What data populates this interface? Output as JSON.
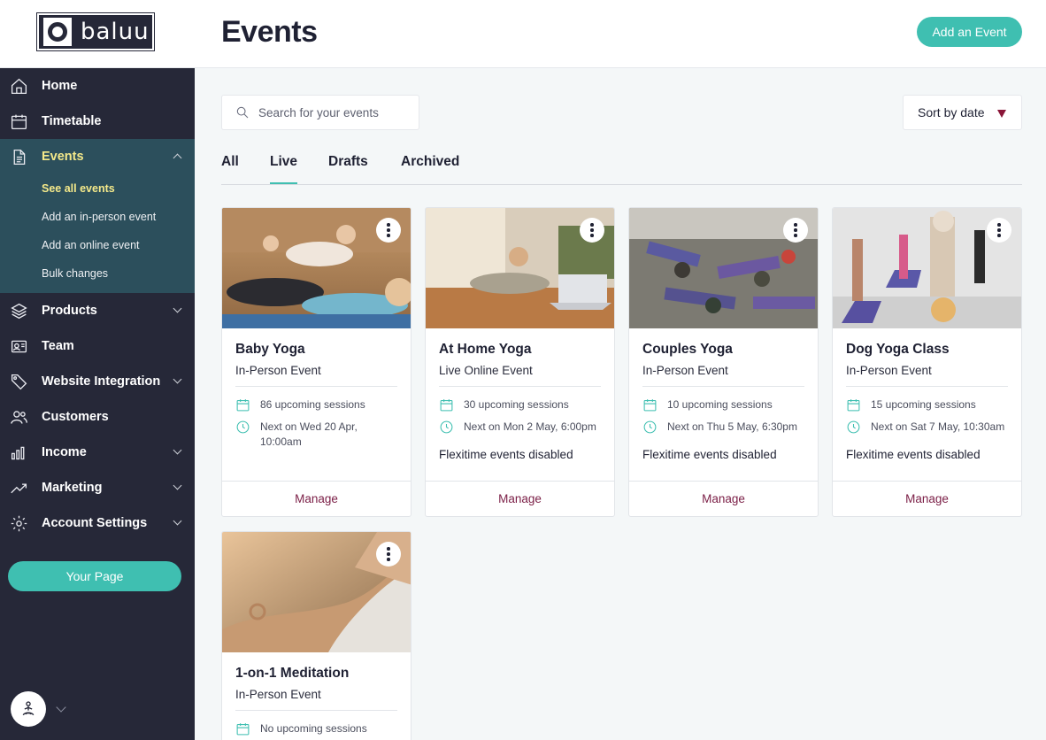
{
  "brand": {
    "name": "baluu",
    "accent": "#3fbfb1",
    "sidebar_bg": "#262838",
    "active_group_bg": "#2c4f5c",
    "highlight": "#f4e98a",
    "manage_color": "#7a1d45"
  },
  "header": {
    "title": "Events",
    "add_button": "Add an Event"
  },
  "sidebar": {
    "items": [
      {
        "label": "Home",
        "icon": "home-icon"
      },
      {
        "label": "Timetable",
        "icon": "calendar-icon"
      },
      {
        "label": "Events",
        "icon": "document-icon",
        "expanded": true,
        "subitems": [
          "See all events",
          "Add an in-person event",
          "Add an online event",
          "Bulk changes"
        ]
      },
      {
        "label": "Products",
        "icon": "layers-icon"
      },
      {
        "label": "Team",
        "icon": "id-card-icon"
      },
      {
        "label": "Website Integration",
        "icon": "tag-icon"
      },
      {
        "label": "Customers",
        "icon": "users-icon"
      },
      {
        "label": "Income",
        "icon": "bar-chart-icon"
      },
      {
        "label": "Marketing",
        "icon": "trend-icon"
      },
      {
        "label": "Account Settings",
        "icon": "gear-icon"
      }
    ],
    "your_page": "Your Page"
  },
  "toolbar": {
    "search_placeholder": "Search for your events",
    "sort_label": "Sort by date"
  },
  "tabs": [
    "All",
    "Live",
    "Drafts",
    "Archived"
  ],
  "active_tab": "Live",
  "events": [
    {
      "title": "Baby Yoga",
      "type": "In-Person Event",
      "sessions": "86 upcoming sessions",
      "next": "Next on Wed 20 Apr, 10:00am",
      "flexi": "",
      "manage": "Manage"
    },
    {
      "title": "At Home Yoga",
      "type": "Live Online Event",
      "sessions": "30 upcoming sessions",
      "next": "Next on Mon 2 May, 6:00pm",
      "flexi": "Flexitime events disabled",
      "manage": "Manage"
    },
    {
      "title": "Couples Yoga",
      "type": "In-Person Event",
      "sessions": "10 upcoming sessions",
      "next": "Next on Thu 5 May, 6:30pm",
      "flexi": "Flexitime events disabled",
      "manage": "Manage"
    },
    {
      "title": "Dog Yoga Class",
      "type": "In-Person Event",
      "sessions": "15 upcoming sessions",
      "next": "Next on Sat 7 May, 10:30am",
      "flexi": "Flexitime events disabled",
      "manage": "Manage"
    },
    {
      "title": "1-on-1 Meditation",
      "type": "In-Person Event",
      "sessions": "No upcoming sessions"
    }
  ]
}
